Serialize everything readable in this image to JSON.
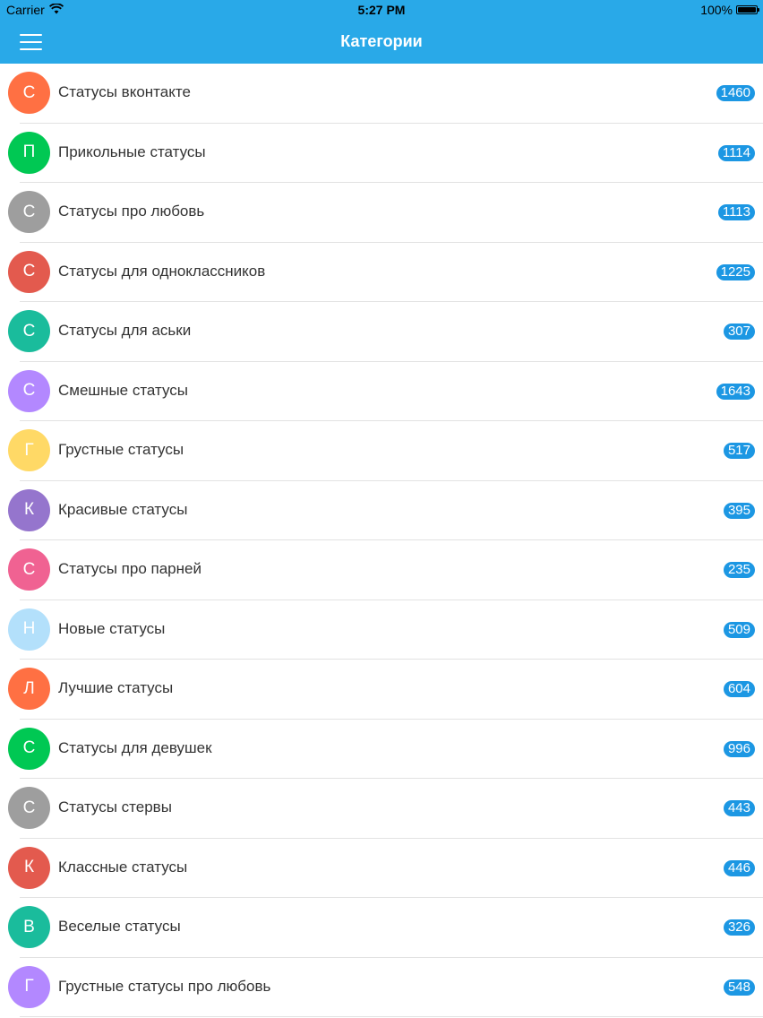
{
  "status_bar": {
    "carrier": "Carrier",
    "time": "5:27 PM",
    "battery": "100%"
  },
  "nav": {
    "title": "Категории"
  },
  "categories": [
    {
      "initial": "С",
      "label": "Статусы вконтакте",
      "count": "1460",
      "color": "#ff7043"
    },
    {
      "initial": "П",
      "label": "Прикольные статусы",
      "count": "1114",
      "color": "#00c853"
    },
    {
      "initial": "С",
      "label": "Статусы про любовь",
      "count": "1113",
      "color": "#9e9e9e"
    },
    {
      "initial": "С",
      "label": "Статусы для одноклассников",
      "count": "1225",
      "color": "#e35a4e"
    },
    {
      "initial": "С",
      "label": "Статусы для аськи",
      "count": "307",
      "color": "#1abc9c"
    },
    {
      "initial": "С",
      "label": "Смешные статусы",
      "count": "1643",
      "color": "#b388ff"
    },
    {
      "initial": "Г",
      "label": "Грустные статусы",
      "count": "517",
      "color": "#ffd966"
    },
    {
      "initial": "К",
      "label": "Красивые статусы",
      "count": "395",
      "color": "#9575cd"
    },
    {
      "initial": "С",
      "label": "Статусы про парней",
      "count": "235",
      "color": "#f06292"
    },
    {
      "initial": "Н",
      "label": "Новые статусы",
      "count": "509",
      "color": "#b3e0fb"
    },
    {
      "initial": "Л",
      "label": "Лучшие статусы",
      "count": "604",
      "color": "#ff7043"
    },
    {
      "initial": "С",
      "label": "Статусы для девушек",
      "count": "996",
      "color": "#00c853"
    },
    {
      "initial": "С",
      "label": "Статусы стервы",
      "count": "443",
      "color": "#9e9e9e"
    },
    {
      "initial": "К",
      "label": "Классные статусы",
      "count": "446",
      "color": "#e35a4e"
    },
    {
      "initial": "В",
      "label": "Веселые статусы",
      "count": "326",
      "color": "#1abc9c"
    },
    {
      "initial": "Г",
      "label": "Грустные статусы про любовь",
      "count": "548",
      "color": "#b388ff"
    }
  ]
}
